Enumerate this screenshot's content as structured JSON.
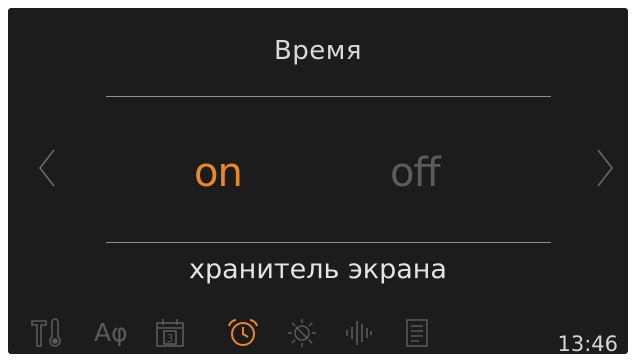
{
  "screen": {
    "title": "Время",
    "subtitle": "хранитель экрана",
    "options": {
      "on_label": "on",
      "off_label": "off",
      "selected": "on"
    },
    "navigation": {
      "prev_icon": "chevron-left-icon",
      "next_icon": "chevron-right-icon"
    }
  },
  "toolbar": {
    "items": [
      {
        "icon": "tools-thermometer-icon"
      },
      {
        "icon": "language-icon",
        "label": "Аφ"
      },
      {
        "icon": "calendar-icon",
        "label": "3"
      },
      {
        "icon": "alarm-clock-icon",
        "active": true
      },
      {
        "icon": "brightness-icon"
      },
      {
        "icon": "sound-icon"
      },
      {
        "icon": "document-icon"
      }
    ],
    "clock": "13:46"
  },
  "colors": {
    "accent": "#e9862e",
    "background": "#1c1c1c",
    "inactive": "#5a5a5a",
    "text": "#d8d8d8"
  }
}
